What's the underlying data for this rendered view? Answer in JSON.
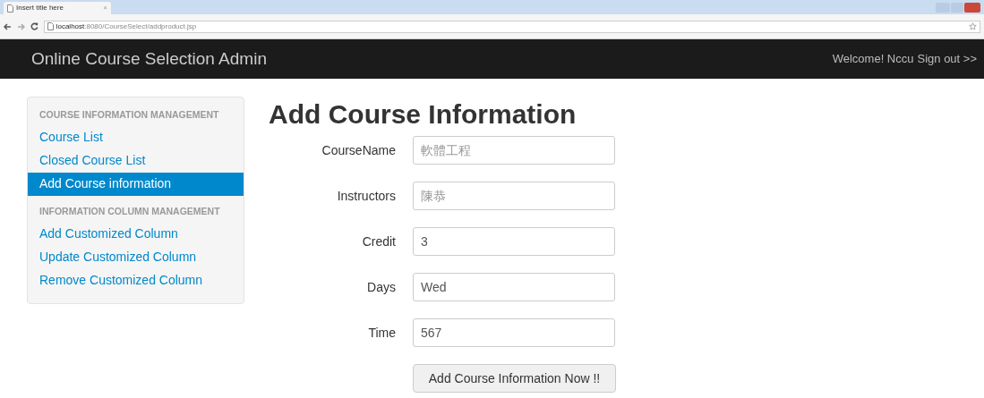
{
  "browser": {
    "tab_title": "Insert title here",
    "tab_close": "×",
    "url_host": "localhost",
    "url_path": ":8080/CourseSelect/addproduct.jsp"
  },
  "navbar": {
    "brand": "Online Course Selection Admin",
    "welcome": "Welcome! Nccu",
    "sign_out": "Sign out >>"
  },
  "sidebar": {
    "sections": [
      {
        "heading": "COURSE INFORMATION MANAGEMENT",
        "items": [
          {
            "label": "Course List",
            "selected": false
          },
          {
            "label": "Closed Course List",
            "selected": false
          },
          {
            "label": "Add Course information",
            "selected": true
          }
        ]
      },
      {
        "heading": "INFORMATION COLUMN MANAGEMENT",
        "items": [
          {
            "label": "Add Customized Column",
            "selected": false
          },
          {
            "label": "Update Customized Column",
            "selected": false
          },
          {
            "label": "Remove Customized Column",
            "selected": false
          }
        ]
      }
    ]
  },
  "form": {
    "title": "Add Course Information",
    "fields": [
      {
        "label": "CourseName",
        "placeholder": "軟體工程"
      },
      {
        "label": "Instructors",
        "placeholder": "陳恭"
      },
      {
        "label": "Credit",
        "value": "3"
      },
      {
        "label": "Days",
        "value": "Wed"
      },
      {
        "label": "Time",
        "value": "567"
      }
    ],
    "submit": "Add Course Information Now !!"
  }
}
